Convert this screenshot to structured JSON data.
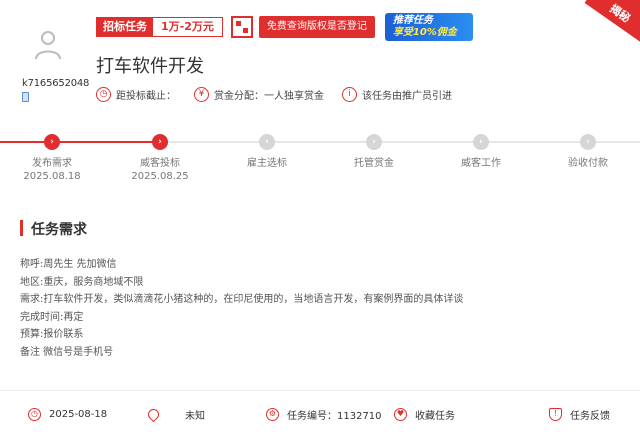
{
  "user": {
    "name": "k7165652048"
  },
  "header": {
    "price_type": "招标任务",
    "price_range": "1万-2万元",
    "ad_red": "免费查询版权是否登记",
    "ad_blue_line1": "推荐任务",
    "ad_blue_line2": "享受10%佣金",
    "corner": "揭秘"
  },
  "task": {
    "title": "打车软件开发",
    "meta": [
      {
        "icon": "clock",
        "text": "距投标截止："
      },
      {
        "icon": "yen",
        "text": "赏金分配：一人独享赏金"
      },
      {
        "icon": "info",
        "text": "该任务由推广员引进"
      }
    ]
  },
  "progress": {
    "steps": [
      {
        "label": "发布需求",
        "date": "2025.08.18",
        "done": true,
        "pos": 52
      },
      {
        "label": "威客投标",
        "date": "2025.08.25",
        "done": true,
        "pos": 160
      },
      {
        "label": "雇主选标",
        "date": "",
        "done": false,
        "pos": 267
      },
      {
        "label": "托管赏金",
        "date": "",
        "done": false,
        "pos": 374
      },
      {
        "label": "威客工作",
        "date": "",
        "done": false,
        "pos": 481
      },
      {
        "label": "验收付款",
        "date": "",
        "done": false,
        "pos": 588
      }
    ]
  },
  "requirements": {
    "section_title": "任务需求",
    "lines": [
      "称呼:周先生 先加微信",
      "地区:重庆，服务商地域不限",
      "需求:打车软件开发，类似滴滴花小猪这种的，在印尼使用的，当地语言开发，有案例界面的具体详谈",
      "完成时间:再定",
      "预算:报价联系",
      "备注 微信号是手机号"
    ]
  },
  "footer": {
    "date": "2025-08-18",
    "location": "未知",
    "task_no": "任务编号：1132710",
    "favorite": "收藏任务",
    "feedback": "任务反馈"
  },
  "colors": {
    "accent": "#e02e2e",
    "inactive": "#d6d6d6"
  }
}
